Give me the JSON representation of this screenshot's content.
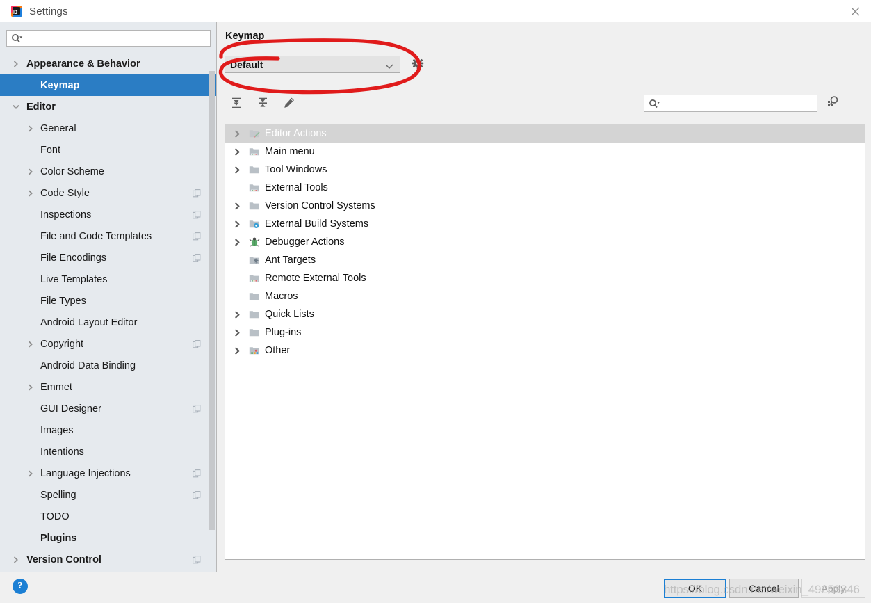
{
  "window": {
    "title": "Settings",
    "app_icon": "intellij-idea-icon",
    "close_icon": "close-icon"
  },
  "sidebar": {
    "search": {
      "placeholder": "",
      "value": "",
      "icon": "search-dropdown-icon"
    },
    "items": [
      {
        "label": "Appearance & Behavior",
        "level": 0,
        "arrow": "chevron-right",
        "bold": true,
        "selected": false,
        "copy": false
      },
      {
        "label": "Keymap",
        "level": 1,
        "arrow": "none",
        "bold": true,
        "selected": true,
        "copy": false
      },
      {
        "label": "Editor",
        "level": 0,
        "arrow": "chevron-down",
        "bold": true,
        "selected": false,
        "copy": false
      },
      {
        "label": "General",
        "level": 1,
        "arrow": "chevron-right",
        "bold": false,
        "selected": false,
        "copy": false
      },
      {
        "label": "Font",
        "level": 1,
        "arrow": "none",
        "bold": false,
        "selected": false,
        "copy": false
      },
      {
        "label": "Color Scheme",
        "level": 1,
        "arrow": "chevron-right",
        "bold": false,
        "selected": false,
        "copy": false
      },
      {
        "label": "Code Style",
        "level": 1,
        "arrow": "chevron-right",
        "bold": false,
        "selected": false,
        "copy": true
      },
      {
        "label": "Inspections",
        "level": 1,
        "arrow": "none",
        "bold": false,
        "selected": false,
        "copy": true
      },
      {
        "label": "File and Code Templates",
        "level": 1,
        "arrow": "none",
        "bold": false,
        "selected": false,
        "copy": true
      },
      {
        "label": "File Encodings",
        "level": 1,
        "arrow": "none",
        "bold": false,
        "selected": false,
        "copy": true
      },
      {
        "label": "Live Templates",
        "level": 1,
        "arrow": "none",
        "bold": false,
        "selected": false,
        "copy": false
      },
      {
        "label": "File Types",
        "level": 1,
        "arrow": "none",
        "bold": false,
        "selected": false,
        "copy": false
      },
      {
        "label": "Android Layout Editor",
        "level": 1,
        "arrow": "none",
        "bold": false,
        "selected": false,
        "copy": false
      },
      {
        "label": "Copyright",
        "level": 1,
        "arrow": "chevron-right",
        "bold": false,
        "selected": false,
        "copy": true
      },
      {
        "label": "Android Data Binding",
        "level": 1,
        "arrow": "none",
        "bold": false,
        "selected": false,
        "copy": false
      },
      {
        "label": "Emmet",
        "level": 1,
        "arrow": "chevron-right",
        "bold": false,
        "selected": false,
        "copy": false
      },
      {
        "label": "GUI Designer",
        "level": 1,
        "arrow": "none",
        "bold": false,
        "selected": false,
        "copy": true
      },
      {
        "label": "Images",
        "level": 1,
        "arrow": "none",
        "bold": false,
        "selected": false,
        "copy": false
      },
      {
        "label": "Intentions",
        "level": 1,
        "arrow": "none",
        "bold": false,
        "selected": false,
        "copy": false
      },
      {
        "label": "Language Injections",
        "level": 1,
        "arrow": "chevron-right",
        "bold": false,
        "selected": false,
        "copy": true
      },
      {
        "label": "Spelling",
        "level": 1,
        "arrow": "none",
        "bold": false,
        "selected": false,
        "copy": true
      },
      {
        "label": "TODO",
        "level": 1,
        "arrow": "none",
        "bold": false,
        "selected": false,
        "copy": false
      },
      {
        "label": "Plugins",
        "level": 1,
        "arrow": "none",
        "bold": true,
        "selected": false,
        "copy": false
      },
      {
        "label": "Version Control",
        "level": 0,
        "arrow": "chevron-right",
        "bold": true,
        "selected": false,
        "copy": true
      }
    ]
  },
  "panel": {
    "title": "Keymap",
    "keymap_select": {
      "value": "Default",
      "chevron_icon": "chevron-down-icon",
      "gear_icon": "gear-icon"
    },
    "toolbar": {
      "buttons": [
        {
          "name": "expand-all-button",
          "icon": "expand-all-icon"
        },
        {
          "name": "collapse-all-button",
          "icon": "collapse-all-icon"
        },
        {
          "name": "edit-shortcut-button",
          "icon": "pencil-icon"
        }
      ]
    },
    "tree_search": {
      "placeholder": "",
      "value": "",
      "icon": "search-dropdown-icon"
    },
    "find_shortcut_button": {
      "name": "find-by-shortcut-button",
      "icon": "find-shortcut-icon"
    },
    "tree": [
      {
        "label": "Editor Actions",
        "arrow": "chevron-right",
        "icon": "folder-editor-icon",
        "selected": true
      },
      {
        "label": "Main menu",
        "arrow": "chevron-right",
        "icon": "folder-menu-icon",
        "selected": false
      },
      {
        "label": "Tool Windows",
        "arrow": "chevron-right",
        "icon": "folder-icon",
        "selected": false
      },
      {
        "label": "External Tools",
        "arrow": "none",
        "icon": "folder-menu-icon",
        "selected": false
      },
      {
        "label": "Version Control Systems",
        "arrow": "chevron-right",
        "icon": "folder-icon",
        "selected": false
      },
      {
        "label": "External Build Systems",
        "arrow": "chevron-right",
        "icon": "folder-gear-icon",
        "selected": false
      },
      {
        "label": "Debugger Actions",
        "arrow": "chevron-right",
        "icon": "bug-icon",
        "selected": false
      },
      {
        "label": "Ant Targets",
        "arrow": "none",
        "icon": "folder-ant-icon",
        "selected": false
      },
      {
        "label": "Remote External Tools",
        "arrow": "none",
        "icon": "folder-menu-icon",
        "selected": false
      },
      {
        "label": "Macros",
        "arrow": "none",
        "icon": "folder-icon",
        "selected": false
      },
      {
        "label": "Quick Lists",
        "arrow": "chevron-right",
        "icon": "folder-icon",
        "selected": false
      },
      {
        "label": "Plug-ins",
        "arrow": "chevron-right",
        "icon": "folder-icon",
        "selected": false
      },
      {
        "label": "Other",
        "arrow": "chevron-right",
        "icon": "folder-dots-icon",
        "selected": false
      }
    ]
  },
  "footer": {
    "help_label": "?",
    "ok_label": "OK",
    "cancel_label": "Cancel",
    "apply_label": "Apply",
    "watermark": "https://blog.csdn.net/weixin_49253846"
  },
  "colors": {
    "accent_blue": "#2b7dc4",
    "sidebar_bg": "#e6eaee",
    "panel_bg": "#f0f0f0",
    "annotation_red": "#e01b1b",
    "tree_selected_bg": "#d4d4d4"
  }
}
